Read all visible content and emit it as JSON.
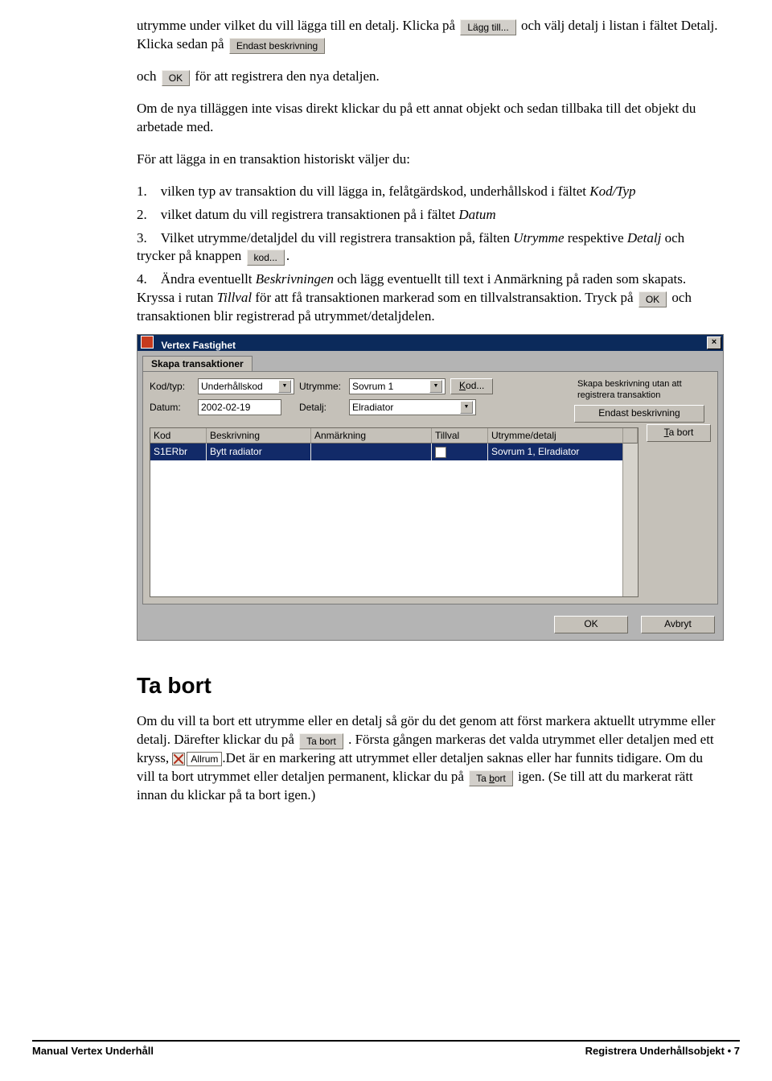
{
  "buttons": {
    "lagg_till": "Lägg till...",
    "endast_beskrivning": "Endast beskrivning",
    "ok": "OK",
    "kod": "kod...",
    "kod_u": "Kod...",
    "ta_bort": "Ta bort",
    "ta_bort_u": "Ta bort",
    "avbryt": "Avbryt"
  },
  "para": {
    "p1a": "utrymme under vilket du vill lägga till en detalj. Klicka på ",
    "p1b": " och välj detalj i listan i fältet Detalj. Klicka sedan på ",
    "p2a": "och ",
    "p2b": " för att registrera den nya detaljen.",
    "p3": "Om de nya tilläggen inte visas direkt klickar du på ett annat objekt och sedan tillbaka till det objekt du arbetade med.",
    "p4": "För att lägga in en transaktion historiskt väljer du:",
    "s1a": "1. vilken typ av transaktion du vill lägga in, felåtgärdskod, underhållskod i fältet ",
    "s1b": "Kod/Typ",
    "s2a": "2. vilket datum du vill registrera transaktionen på i fältet ",
    "s2b": "Datum",
    "s3a": "3. Vilket utrymme/detaljdel du vill registrera transaktion på, fälten ",
    "s3b": "Utrymme",
    "s3c": " respektive ",
    "s3d": "Detalj",
    "s3e": " och trycker på knappen ",
    "s4a": "4. Ändra eventuellt ",
    "s4b": "Beskrivningen",
    "s4c": " och lägg eventuellt till text i Anmärkning på raden som skapats. Kryssa i rutan ",
    "s4d": "Tillval",
    "s4e": " för att få transaktionen markerad som en tillvalstransaktion. Tryck på ",
    "s4f": " och transaktionen blir registrerad på utrymmet/detaljdelen."
  },
  "window": {
    "title": "Vertex Fastighet",
    "tab": "Skapa transaktioner",
    "labels": {
      "kodtyp": "Kod/typ:",
      "utrymme": "Utrymme:",
      "datum": "Datum:",
      "detalj": "Detalj:"
    },
    "values": {
      "kodtyp": "Underhållskod",
      "utrymme": "Sovrum 1",
      "datum": "2002-02-19",
      "detalj": "Elradiator"
    },
    "side_text": "Skapa beskrivning utan att registrera transaktion",
    "grid": {
      "headers": [
        "Kod",
        "Beskrivning",
        "Anmärkning",
        "Tillval",
        "Utrymme/detalj"
      ],
      "row": {
        "kod": "S1ERbr",
        "beskrivning": "Bytt radiator",
        "anm": "",
        "tillval": "",
        "utrymme": "Sovrum 1, Elradiator"
      }
    }
  },
  "section2": {
    "heading": "Ta bort",
    "p1a": "Om du vill ta bort ett utrymme eller en detalj så gör du det genom att först markera aktuellt utrymme eller detalj. Därefter klickar du på ",
    "p1b": ". Första gången markeras det valda utrymmet eller detaljen med ett kryss, ",
    "allrum": "Allrum",
    "p1c": ".Det är en markering att utrymmet eller detaljen saknas eller har funnits tidigare. Om du vill ta bort utrymmet eller detaljen permanent, klickar du på ",
    "p1d": " igen. (Se till att du markerat rätt innan du klickar på ta bort igen.)"
  },
  "footer": {
    "left": "Manual Vertex Underhåll",
    "right": "Registrera Underhållsobjekt  •  7"
  }
}
